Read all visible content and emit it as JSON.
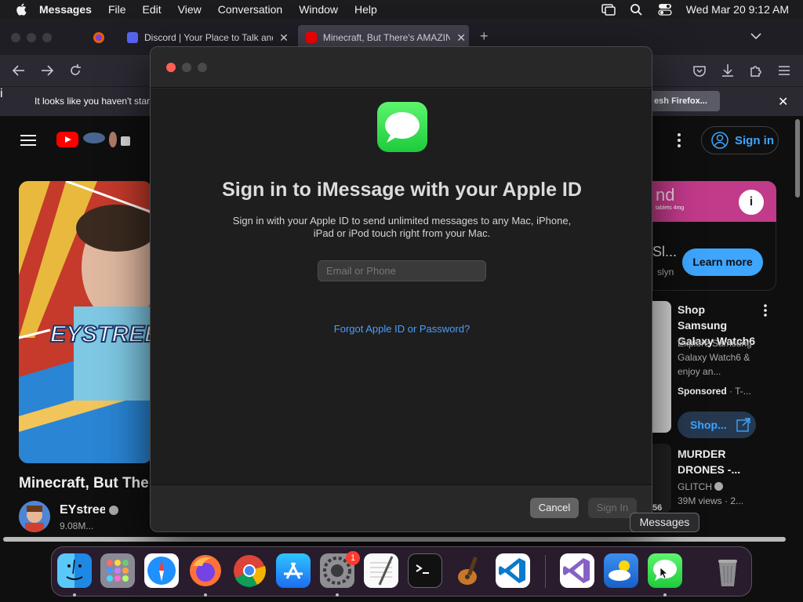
{
  "menubar": {
    "app_name": "Messages",
    "items": [
      "File",
      "Edit",
      "View",
      "Conversation",
      "Window",
      "Help"
    ],
    "datetime": "Wed Mar 20  9:12 AM"
  },
  "browser": {
    "tabs": [
      {
        "label": "Discord | Your Place to Talk and",
        "icon": "discord-icon"
      },
      {
        "label": "Minecraft, But There's AMAZING",
        "icon": "youtube-icon"
      }
    ],
    "notice_text": "It looks like you haven't start",
    "notice_button": "esh Firefox..."
  },
  "youtube": {
    "signin_label": "Sign in",
    "video_title": "Minecraft, But The",
    "channel_name": "EYstreem",
    "subscribers": "9.08M...",
    "thumbnail_text": "EYSTREE",
    "ad": {
      "banner_text": "nd",
      "banner_small": "tablets 4mg",
      "title": "Sl...",
      "subtitle": "slyn",
      "button": "Learn more"
    },
    "recs": [
      {
        "title": "Shop Samsung Galaxy Watch6",
        "desc": "Explore Samsung Galaxy Watch6 & enjoy an...",
        "sponsored": "Sponsored",
        "sponsored_suffix": " · T-...",
        "button": "Shop..."
      },
      {
        "title": "MURDER DRONES -...",
        "channel": "GLITCH",
        "meta": "39M views  · 2...",
        "duration": "56"
      }
    ]
  },
  "dialog": {
    "title": "Sign in to iMessage with your Apple ID",
    "subtitle": "Sign in with your Apple ID to send unlimited messages to any Mac, iPhone, iPad or iPod touch right from your Mac.",
    "email_placeholder": "Email or Phone",
    "forgot_link": "Forgot Apple ID or Password?",
    "cancel": "Cancel",
    "signin": "Sign In"
  },
  "dock": {
    "tooltip": "Messages",
    "settings_badge": "1"
  }
}
